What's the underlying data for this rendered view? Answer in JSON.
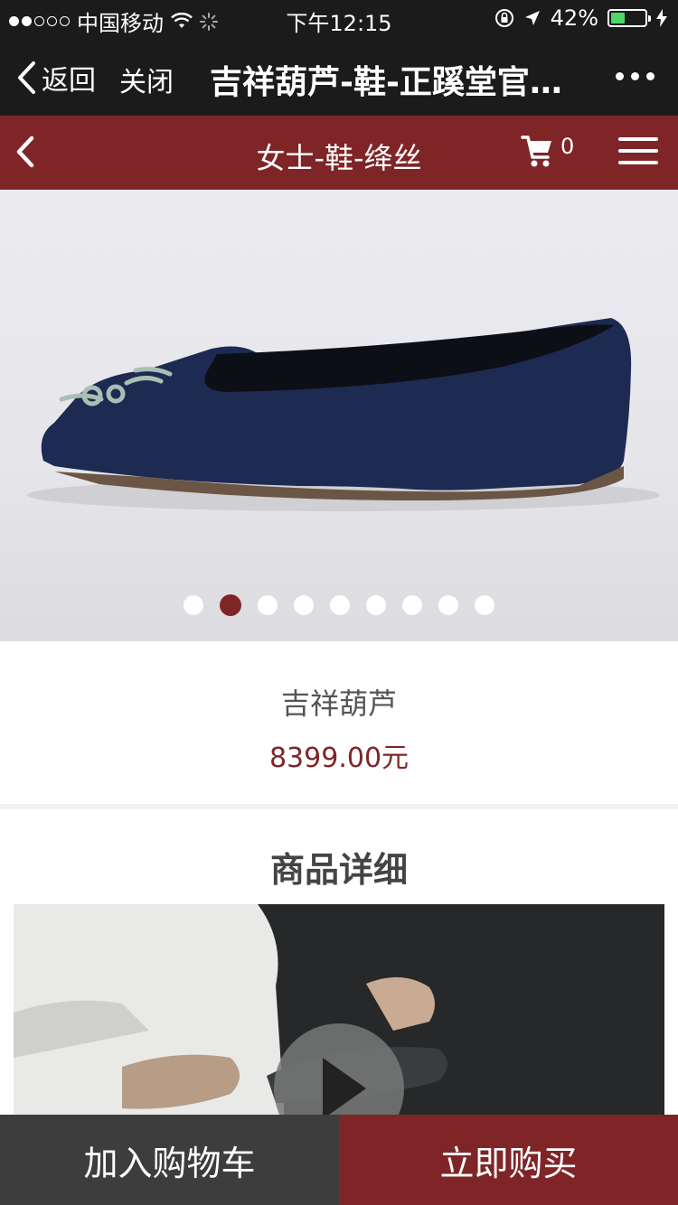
{
  "status_bar": {
    "carrier": "中国移动",
    "time": "下午12:15",
    "battery": "42%",
    "battery_level": 0.42,
    "battery_color": "#4cd964"
  },
  "wechat_nav": {
    "back_label": "返回",
    "close_label": "关闭",
    "title": "吉祥葫芦-鞋-正蹊堂官…",
    "more_icon": "more-dots-icon"
  },
  "site_header": {
    "title": "女士-鞋-绛丝",
    "cart_count": "0",
    "accent_color": "#7f2528"
  },
  "gallery": {
    "slide_count": 9,
    "active_index": 1
  },
  "product": {
    "name": "吉祥葫芦",
    "price": "8399.00元"
  },
  "details": {
    "heading": "商品详细"
  },
  "bottom_bar": {
    "add_to_cart_label": "加入购物车",
    "buy_now_label": "立即购买"
  }
}
